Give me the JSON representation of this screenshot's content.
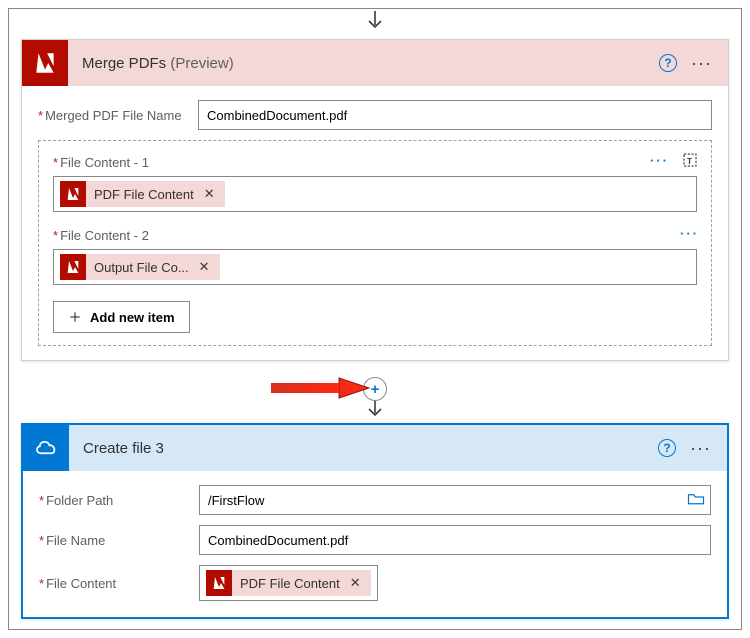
{
  "merge_card": {
    "title": "Merge PDFs",
    "preview": "(Preview)",
    "filename_label": "Merged PDF File Name",
    "filename_value": "CombinedDocument.pdf",
    "content1_label": "File Content - 1",
    "content1_token": "PDF File Content",
    "content2_label": "File Content - 2",
    "content2_token": "Output File Co...",
    "add_item_label": "Add new item"
  },
  "create_card": {
    "title": "Create file 3",
    "folder_label": "Folder Path",
    "folder_value": "/FirstFlow",
    "filename_label": "File Name",
    "filename_value": "CombinedDocument.pdf",
    "content_label": "File Content",
    "content_token": "PDF File Content"
  }
}
